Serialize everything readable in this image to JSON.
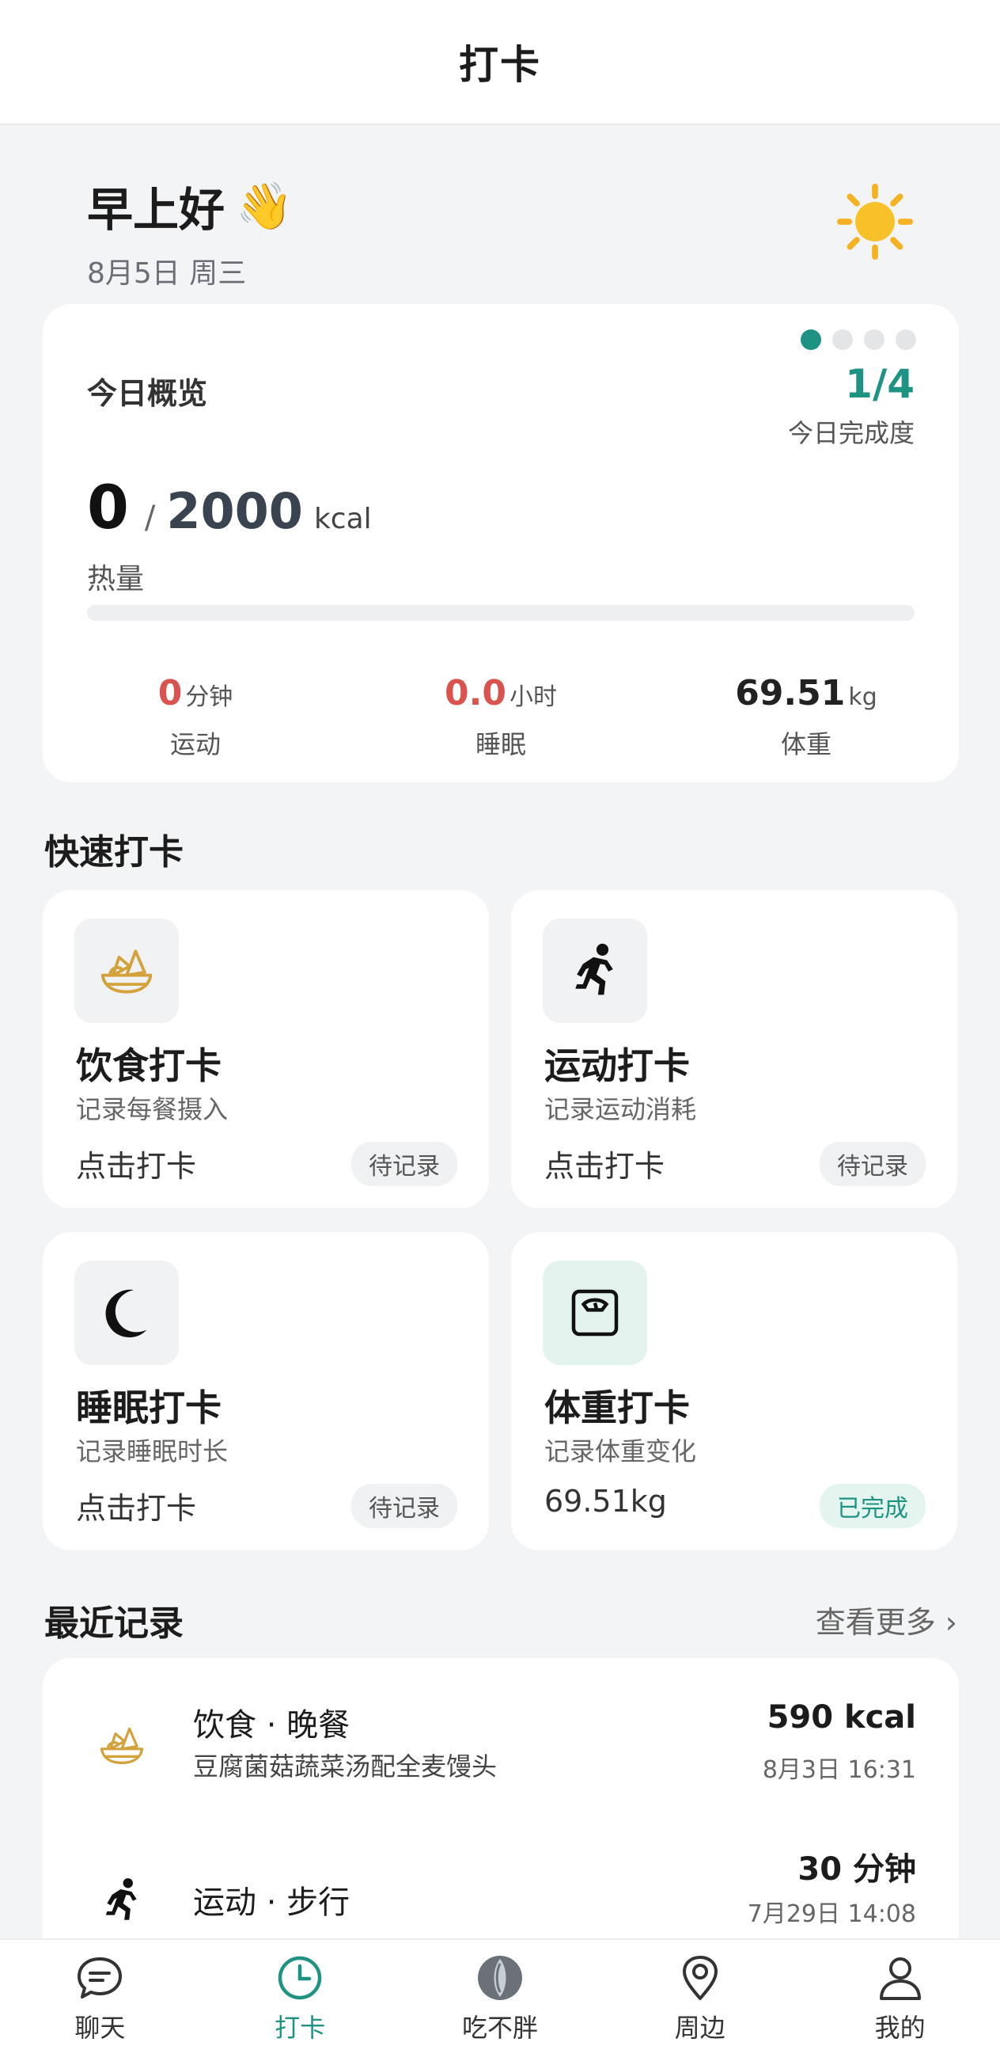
{
  "header": {
    "title": "打卡"
  },
  "greeting": {
    "text": "早上好",
    "wave_emoji": "👋",
    "date": "8月5日 周三",
    "weather_icon": "sun-icon"
  },
  "overview": {
    "title": "今日概览",
    "progress": "1/4",
    "progress_fraction": 0.25,
    "progress_label": "今日完成度",
    "calories_current": "0",
    "calories_separator": "/",
    "calories_goal": "2000",
    "calories_unit": "kcal",
    "calories_label": "热量",
    "calories_fill_fraction": 0,
    "stats": [
      {
        "value": "0",
        "unit": "分钟",
        "label": "运动"
      },
      {
        "value": "0.0",
        "unit": "小时",
        "label": "睡眠"
      },
      {
        "value": "69.51",
        "unit": "kg",
        "label": "体重"
      }
    ]
  },
  "quick": {
    "title": "快速打卡",
    "cards": [
      {
        "title": "饮食打卡",
        "subtitle": "记录每餐摄入",
        "action": "点击打卡",
        "status": "待记录",
        "icon": "food-bowl-icon"
      },
      {
        "title": "运动打卡",
        "subtitle": "记录运动消耗",
        "action": "点击打卡",
        "status": "待记录",
        "icon": "running-icon"
      },
      {
        "title": "睡眠打卡",
        "subtitle": "记录睡眠时长",
        "action": "点击打卡",
        "status": "待记录",
        "icon": "moon-icon"
      },
      {
        "title": "体重打卡",
        "subtitle": "记录体重变化",
        "action": "69.51kg",
        "status": "已完成",
        "icon": "scale-icon"
      }
    ]
  },
  "recent": {
    "title": "最近记录",
    "more": "查看更多 ›",
    "items": [
      {
        "title": "饮食 · 晚餐",
        "subtitle": "豆腐菌菇蔬菜汤配全麦馒头",
        "value": "590 kcal",
        "time": "8月3日 16:31",
        "icon": "food-bowl-icon"
      },
      {
        "title": "运动 · 步行",
        "subtitle": "",
        "value": "30 分钟",
        "time": "7月29日 14:08",
        "icon": "running-icon"
      }
    ]
  },
  "tabs": [
    {
      "label": "聊天",
      "icon": "chat-icon"
    },
    {
      "label": "打卡",
      "icon": "clock-icon"
    },
    {
      "label": "吃不胖",
      "icon": "app-logo-icon"
    },
    {
      "label": "周边",
      "icon": "location-pin-icon"
    },
    {
      "label": "我的",
      "icon": "profile-icon"
    }
  ],
  "colors": {
    "accent": "#1e9384",
    "warning": "#d9534f",
    "food": "#d4a23a"
  }
}
